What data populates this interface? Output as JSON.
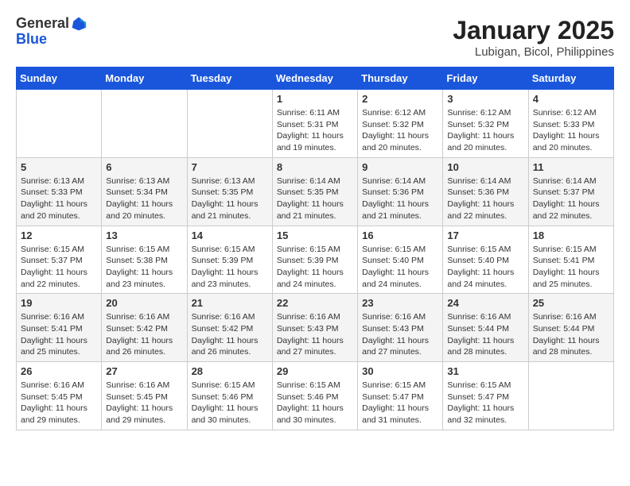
{
  "header": {
    "logo_line1": "General",
    "logo_line2": "Blue",
    "month_title": "January 2025",
    "location": "Lubigan, Bicol, Philippines"
  },
  "weekdays": [
    "Sunday",
    "Monday",
    "Tuesday",
    "Wednesday",
    "Thursday",
    "Friday",
    "Saturday"
  ],
  "weeks": [
    [
      {
        "day": "",
        "info": ""
      },
      {
        "day": "",
        "info": ""
      },
      {
        "day": "",
        "info": ""
      },
      {
        "day": "1",
        "info": "Sunrise: 6:11 AM\nSunset: 5:31 PM\nDaylight: 11 hours\nand 19 minutes."
      },
      {
        "day": "2",
        "info": "Sunrise: 6:12 AM\nSunset: 5:32 PM\nDaylight: 11 hours\nand 20 minutes."
      },
      {
        "day": "3",
        "info": "Sunrise: 6:12 AM\nSunset: 5:32 PM\nDaylight: 11 hours\nand 20 minutes."
      },
      {
        "day": "4",
        "info": "Sunrise: 6:12 AM\nSunset: 5:33 PM\nDaylight: 11 hours\nand 20 minutes."
      }
    ],
    [
      {
        "day": "5",
        "info": "Sunrise: 6:13 AM\nSunset: 5:33 PM\nDaylight: 11 hours\nand 20 minutes."
      },
      {
        "day": "6",
        "info": "Sunrise: 6:13 AM\nSunset: 5:34 PM\nDaylight: 11 hours\nand 20 minutes."
      },
      {
        "day": "7",
        "info": "Sunrise: 6:13 AM\nSunset: 5:35 PM\nDaylight: 11 hours\nand 21 minutes."
      },
      {
        "day": "8",
        "info": "Sunrise: 6:14 AM\nSunset: 5:35 PM\nDaylight: 11 hours\nand 21 minutes."
      },
      {
        "day": "9",
        "info": "Sunrise: 6:14 AM\nSunset: 5:36 PM\nDaylight: 11 hours\nand 21 minutes."
      },
      {
        "day": "10",
        "info": "Sunrise: 6:14 AM\nSunset: 5:36 PM\nDaylight: 11 hours\nand 22 minutes."
      },
      {
        "day": "11",
        "info": "Sunrise: 6:14 AM\nSunset: 5:37 PM\nDaylight: 11 hours\nand 22 minutes."
      }
    ],
    [
      {
        "day": "12",
        "info": "Sunrise: 6:15 AM\nSunset: 5:37 PM\nDaylight: 11 hours\nand 22 minutes."
      },
      {
        "day": "13",
        "info": "Sunrise: 6:15 AM\nSunset: 5:38 PM\nDaylight: 11 hours\nand 23 minutes."
      },
      {
        "day": "14",
        "info": "Sunrise: 6:15 AM\nSunset: 5:39 PM\nDaylight: 11 hours\nand 23 minutes."
      },
      {
        "day": "15",
        "info": "Sunrise: 6:15 AM\nSunset: 5:39 PM\nDaylight: 11 hours\nand 24 minutes."
      },
      {
        "day": "16",
        "info": "Sunrise: 6:15 AM\nSunset: 5:40 PM\nDaylight: 11 hours\nand 24 minutes."
      },
      {
        "day": "17",
        "info": "Sunrise: 6:15 AM\nSunset: 5:40 PM\nDaylight: 11 hours\nand 24 minutes."
      },
      {
        "day": "18",
        "info": "Sunrise: 6:15 AM\nSunset: 5:41 PM\nDaylight: 11 hours\nand 25 minutes."
      }
    ],
    [
      {
        "day": "19",
        "info": "Sunrise: 6:16 AM\nSunset: 5:41 PM\nDaylight: 11 hours\nand 25 minutes."
      },
      {
        "day": "20",
        "info": "Sunrise: 6:16 AM\nSunset: 5:42 PM\nDaylight: 11 hours\nand 26 minutes."
      },
      {
        "day": "21",
        "info": "Sunrise: 6:16 AM\nSunset: 5:42 PM\nDaylight: 11 hours\nand 26 minutes."
      },
      {
        "day": "22",
        "info": "Sunrise: 6:16 AM\nSunset: 5:43 PM\nDaylight: 11 hours\nand 27 minutes."
      },
      {
        "day": "23",
        "info": "Sunrise: 6:16 AM\nSunset: 5:43 PM\nDaylight: 11 hours\nand 27 minutes."
      },
      {
        "day": "24",
        "info": "Sunrise: 6:16 AM\nSunset: 5:44 PM\nDaylight: 11 hours\nand 28 minutes."
      },
      {
        "day": "25",
        "info": "Sunrise: 6:16 AM\nSunset: 5:44 PM\nDaylight: 11 hours\nand 28 minutes."
      }
    ],
    [
      {
        "day": "26",
        "info": "Sunrise: 6:16 AM\nSunset: 5:45 PM\nDaylight: 11 hours\nand 29 minutes."
      },
      {
        "day": "27",
        "info": "Sunrise: 6:16 AM\nSunset: 5:45 PM\nDaylight: 11 hours\nand 29 minutes."
      },
      {
        "day": "28",
        "info": "Sunrise: 6:15 AM\nSunset: 5:46 PM\nDaylight: 11 hours\nand 30 minutes."
      },
      {
        "day": "29",
        "info": "Sunrise: 6:15 AM\nSunset: 5:46 PM\nDaylight: 11 hours\nand 30 minutes."
      },
      {
        "day": "30",
        "info": "Sunrise: 6:15 AM\nSunset: 5:47 PM\nDaylight: 11 hours\nand 31 minutes."
      },
      {
        "day": "31",
        "info": "Sunrise: 6:15 AM\nSunset: 5:47 PM\nDaylight: 11 hours\nand 32 minutes."
      },
      {
        "day": "",
        "info": ""
      }
    ]
  ]
}
